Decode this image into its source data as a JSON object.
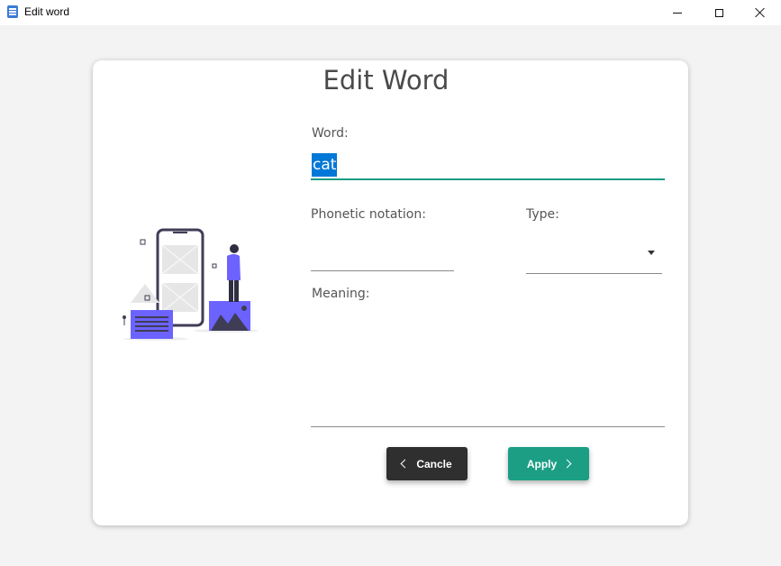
{
  "window": {
    "title": "Edit word"
  },
  "dialog": {
    "heading": "Edit Word",
    "word_label": "Word:",
    "word_value": "cat",
    "phonetic_label": "Phonetic notation:",
    "phonetic_value": "",
    "type_label": "Type:",
    "type_value": "",
    "meaning_label": "Meaning:",
    "meaning_value": "",
    "cancel_label": "Cancle",
    "apply_label": "Apply"
  },
  "colors": {
    "accent": "#179b84",
    "apply_button": "#1c9e85",
    "cancel_button": "#2f2f2f",
    "selection": "#0078d7",
    "illustration_purple": "#6c63ff"
  }
}
